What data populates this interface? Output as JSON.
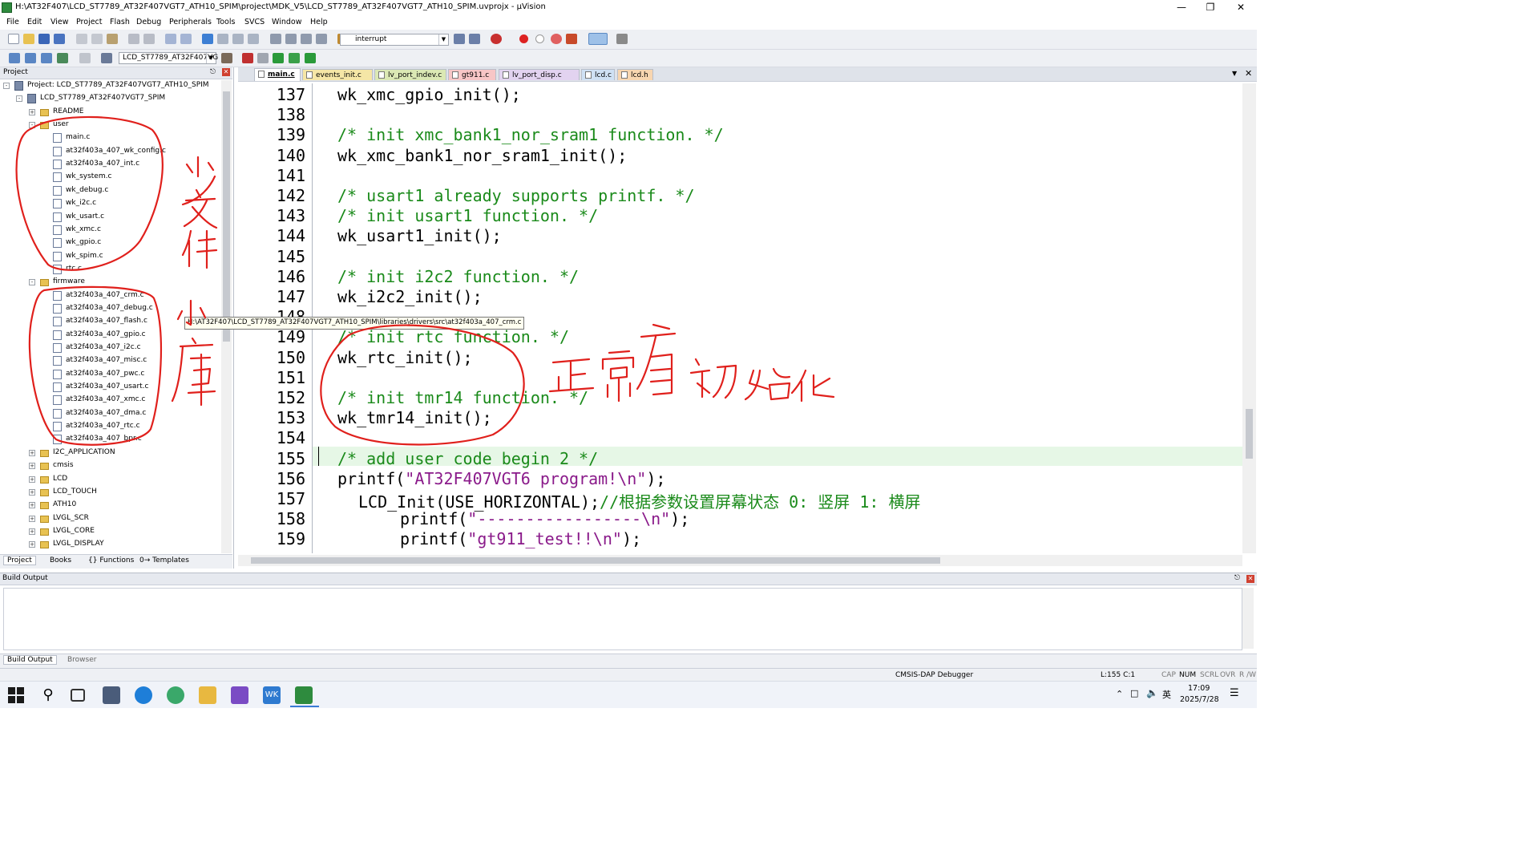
{
  "window": {
    "title": "H:\\AT32F407\\LCD_ST7789_AT32F407VGT7_ATH10_SPIM\\project\\MDK_V5\\LCD_ST7789_AT32F407VGT7_ATH10_SPIM.uvprojx - µVision"
  },
  "menu": [
    "File",
    "Edit",
    "View",
    "Project",
    "Flash",
    "Debug",
    "Peripherals",
    "Tools",
    "SVCS",
    "Window",
    "Help"
  ],
  "toolbar": {
    "find_value": "interrupt",
    "target_value": "LCD_ST7789_AT32F407VG"
  },
  "project_panel": {
    "header": "Project",
    "root": "Project: LCD_ST7789_AT32F407VGT7_ATH10_SPIM",
    "target": "LCD_ST7789_AT32F407VGT7_SPIM",
    "groups_top": [
      "README"
    ],
    "user_group": "user",
    "user_files": [
      "main.c",
      "at32f403a_407_wk_config.c",
      "at32f403a_407_int.c",
      "wk_system.c",
      "wk_debug.c",
      "wk_i2c.c",
      "wk_usart.c",
      "wk_xmc.c",
      "wk_gpio.c",
      "wk_spim.c",
      "rtc.c"
    ],
    "firmware_group": "firmware",
    "firmware_files": [
      "at32f403a_407_crm.c",
      "at32f403a_407_debug.c",
      "at32f403a_407_flash.c",
      "at32f403a_407_gpio.c",
      "at32f403a_407_i2c.c",
      "at32f403a_407_misc.c",
      "at32f403a_407_pwc.c",
      "at32f403a_407_usart.c",
      "at32f403a_407_xmc.c",
      "at32f403a_407_dma.c",
      "at32f403a_407_rtc.c",
      "at32f403a_407_bpr.c"
    ],
    "other_groups": [
      "I2C_APPLICATION",
      "cmsis",
      "LCD",
      "LCD_TOUCH",
      "ATH10",
      "LVGL_SCR",
      "LVGL_CORE",
      "LVGL_DISPLAY"
    ],
    "tabs": [
      "Project",
      "Books",
      "{} Functions",
      "0→ Templates"
    ]
  },
  "tooltip": "H:\\AT32F407\\LCD_ST7789_AT32F407VGT7_ATH10_SPIM\\libraries\\drivers\\src\\at32f403a_407_crm.c",
  "editor": {
    "tabs": [
      {
        "label": "main.c",
        "color": "#ffffff",
        "active": true
      },
      {
        "label": "events_init.c",
        "color": "#f5e6a6"
      },
      {
        "label": "lv_port_indev.c",
        "color": "#dbe8b4"
      },
      {
        "label": "gt911.c",
        "color": "#f7c6c6"
      },
      {
        "label": "lv_port_disp.c",
        "color": "#e2d3f0"
      },
      {
        "label": "lcd.c",
        "color": "#cfe1f4"
      },
      {
        "label": "lcd.h",
        "color": "#f8d6b0"
      }
    ],
    "lines": [
      {
        "n": "137",
        "indent": 0,
        "text": "wk_xmc_gpio_init();",
        "kind": "code"
      },
      {
        "n": "138",
        "indent": 0,
        "text": "",
        "kind": "code"
      },
      {
        "n": "139",
        "indent": 0,
        "text": "/* init xmc_bank1_nor_sram1 function. */",
        "kind": "cmt"
      },
      {
        "n": "140",
        "indent": 0,
        "text": "wk_xmc_bank1_nor_sram1_init();",
        "kind": "code"
      },
      {
        "n": "141",
        "indent": 0,
        "text": "",
        "kind": "code"
      },
      {
        "n": "142",
        "indent": 0,
        "text": "/* usart1 already supports printf. */",
        "kind": "cmt"
      },
      {
        "n": "143",
        "indent": 0,
        "text": "/* init usart1 function. */",
        "kind": "cmt"
      },
      {
        "n": "144",
        "indent": 0,
        "text": "wk_usart1_init();",
        "kind": "code"
      },
      {
        "n": "145",
        "indent": 0,
        "text": "",
        "kind": "code"
      },
      {
        "n": "146",
        "indent": 0,
        "text": "/* init i2c2 function. */",
        "kind": "cmt"
      },
      {
        "n": "147",
        "indent": 0,
        "text": "wk_i2c2_init();",
        "kind": "code"
      },
      {
        "n": "148",
        "indent": 0,
        "text": "",
        "kind": "code"
      },
      {
        "n": "149",
        "indent": 0,
        "text": "/* init rtc function. */",
        "kind": "cmt"
      },
      {
        "n": "150",
        "indent": 0,
        "text": "wk_rtc_init();",
        "kind": "code"
      },
      {
        "n": "151",
        "indent": 0,
        "text": "",
        "kind": "code"
      },
      {
        "n": "152",
        "indent": 0,
        "text": "/* init tmr14 function. */",
        "kind": "cmt"
      },
      {
        "n": "153",
        "indent": 0,
        "text": "wk_tmr14_init();",
        "kind": "code"
      },
      {
        "n": "154",
        "indent": 0,
        "text": "",
        "kind": "code"
      },
      {
        "n": "155",
        "indent": 0,
        "text": "/* add user code begin 2 */",
        "kind": "cmt"
      },
      {
        "n": "156",
        "indent": 0,
        "pre": "printf(",
        "str": "\"AT32F407VGT6 program!\\n\"",
        "post": ");",
        "kind": "mix"
      },
      {
        "n": "157",
        "indent": 1,
        "pre": "LCD_Init(USE_HORIZONTAL);",
        "cmt": "//根据参数设置屏幕状态 0: 竖屏 1: 横屏",
        "kind": "codecmt"
      },
      {
        "n": "158",
        "indent": 3,
        "pre": "printf(",
        "str": "\"-----------------\\n\"",
        "post": ");",
        "kind": "mix"
      },
      {
        "n": "159",
        "indent": 3,
        "pre": "printf(",
        "str": "\"gt911_test!!\\n\"",
        "post": ");",
        "kind": "mix"
      }
    ]
  },
  "build_panel": {
    "header": "Build Output",
    "tabs": [
      "Build Output",
      "Browser"
    ]
  },
  "status": {
    "debugger": "CMSIS-DAP Debugger",
    "position": "L:155 C:1",
    "caps": "CAP",
    "num": "NUM",
    "scrl": "SCRL",
    "ovr": "OVR",
    "rw": "R /W"
  },
  "taskbar": {
    "time": "17:09",
    "date": "2025/7/28",
    "ime": "英"
  },
  "colors": {
    "comment": "#1a8a1a",
    "string": "#8a1a8a",
    "current_line": "#e6f7e6",
    "annotation": "#e0201c"
  },
  "annotations": {
    "user_group_note": "少文件",
    "firmware_group_note": "小库",
    "init_note": "正常有初始化"
  }
}
